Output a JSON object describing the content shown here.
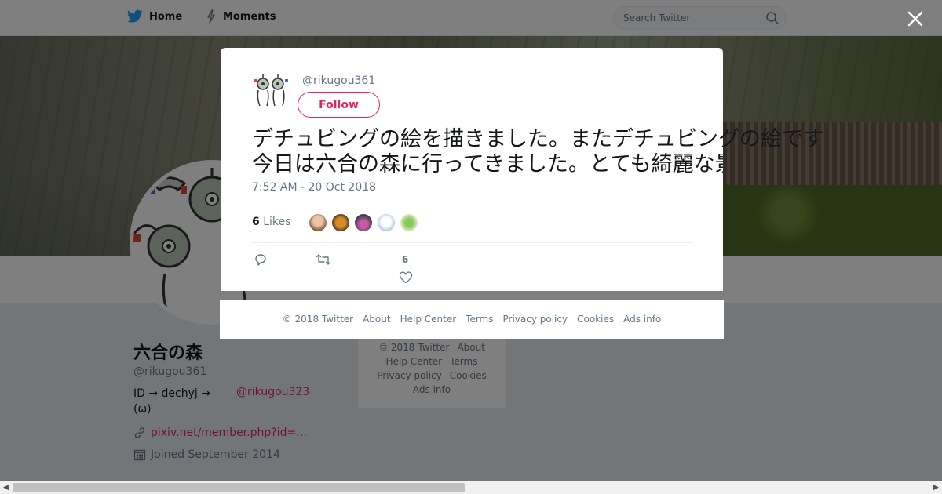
{
  "header": {
    "home_label": "Home",
    "moments_label": "Moments",
    "search_placeholder": "Search Twitter"
  },
  "profile": {
    "name": "六合の森",
    "handle": "@rikugou361",
    "bio_prefix": "ID → dechyj  →",
    "bio_suffix": "(ω)",
    "bio_mention": "@rikugou323",
    "link": "pixiv.net/member.php?id=…",
    "joined": "Joined September 2014"
  },
  "background_footer": {
    "items": [
      "© 2018 Twitter",
      "About",
      "Help Center",
      "Terms",
      "Privacy policy",
      "Cookies",
      "Ads info"
    ]
  },
  "modal": {
    "handle": "@rikugou361",
    "follow_label": "Follow",
    "tweet_line1": "デチュビングの絵を描きました。またデチュビングの絵です",
    "tweet_line2": "今日は六合の森に行ってきました。とても綺麗な景色でした。また来週も行きたいと思います。デチュビングの絵も描きました。",
    "time": "7:52 AM - 20 Oct 2018",
    "likes_count": "6",
    "likes_label": "Likes",
    "like_action_count": "6"
  },
  "modal_footer": {
    "items": [
      "© 2018 Twitter",
      "About",
      "Help Center",
      "Terms",
      "Privacy policy",
      "Cookies",
      "Ads info"
    ]
  },
  "colors": {
    "accent": "#e0245e",
    "twitter_blue": "#1da1f2",
    "muted_text": "#657786"
  }
}
